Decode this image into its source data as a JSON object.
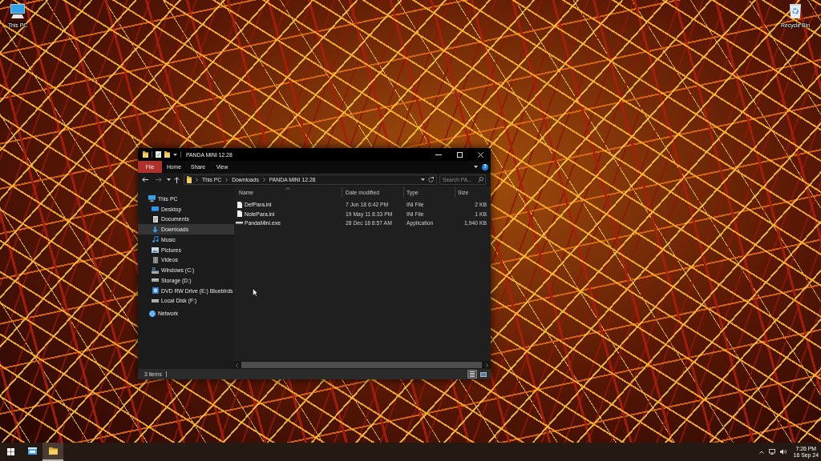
{
  "desktop": {
    "icons": [
      {
        "label": "This PC",
        "kind": "computer"
      },
      {
        "label": "Recycle Bin",
        "kind": "recycle_bin"
      }
    ]
  },
  "window": {
    "title": "PANDA MINI 12.28",
    "ribbon_tabs": [
      {
        "label": "File",
        "kind": "menu",
        "selected": false
      },
      {
        "label": "Home",
        "kind": "tab",
        "selected": false
      },
      {
        "label": "Share",
        "kind": "tab",
        "selected": false
      },
      {
        "label": "View",
        "kind": "tab",
        "selected": false
      }
    ],
    "help": "?",
    "address_bar": {
      "segments": [
        "This PC",
        "Downloads",
        "PANDA MINI 12.28"
      ]
    },
    "search": {
      "placeholder": "Search PA..."
    },
    "navigation": {
      "items": [
        {
          "label": "This PC",
          "kind": "computer",
          "selected": false,
          "children": [
            {
              "label": "Desktop",
              "kind": "desktop",
              "selected": false
            },
            {
              "label": "Documents",
              "kind": "documents",
              "selected": false
            },
            {
              "label": "Downloads",
              "kind": "downloads",
              "selected": true
            },
            {
              "label": "Music",
              "kind": "music",
              "selected": false
            },
            {
              "label": "Pictures",
              "kind": "pictures",
              "selected": false
            },
            {
              "label": "Videos",
              "kind": "videos",
              "selected": false
            },
            {
              "label": "Windows (C:)",
              "kind": "system_drive",
              "selected": false
            },
            {
              "label": "Storage (D:)",
              "kind": "drive",
              "selected": false
            },
            {
              "label": "DVD RW Drive (E:) Bluebirds",
              "kind": "disc",
              "selected": false
            },
            {
              "label": "Local Disk (F:)",
              "kind": "drive",
              "selected": false
            }
          ]
        },
        {
          "label": "Network",
          "kind": "network",
          "selected": false
        }
      ]
    },
    "file_list": {
      "columns": [
        {
          "label": "Name",
          "sorted": true
        },
        {
          "label": "Date modified",
          "sorted": false
        },
        {
          "label": "Type",
          "sorted": false
        },
        {
          "label": "Size",
          "sorted": false
        }
      ],
      "rows": [
        {
          "name": "DefPara.ini",
          "date_modified": "7 Jun 18 6:42 PM",
          "type": "INI File",
          "size": "2 KB",
          "kind": "document",
          "selected": false
        },
        {
          "name": "NotePara.ini",
          "date_modified": "19 May 11 8:33 PM",
          "type": "INI File",
          "size": "1 KB",
          "kind": "document",
          "selected": false
        },
        {
          "name": "PandaMini.exe",
          "date_modified": "28 Dec 18 8:57 AM",
          "type": "Application",
          "size": "1,940 KB",
          "kind": "program",
          "selected": false
        }
      ]
    },
    "status_bar": {
      "item_count": "3 items",
      "views": [
        {
          "kind": "details",
          "selected": true
        },
        {
          "kind": "large_icons",
          "selected": false
        }
      ]
    }
  },
  "taskbar": {
    "apps": [
      {
        "kind": "window",
        "active": false
      },
      {
        "kind": "folder",
        "active": true
      }
    ],
    "clock": {
      "time": "7:26 PM",
      "date": "16 Sep 24"
    }
  }
}
